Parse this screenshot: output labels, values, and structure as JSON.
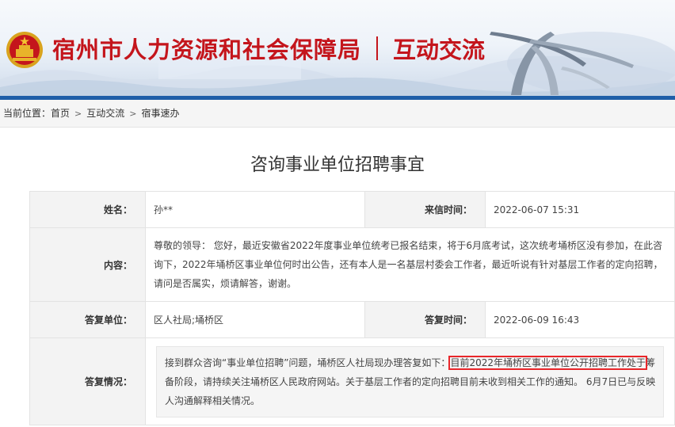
{
  "header": {
    "site_title": "宿州市人力资源和社会保障局",
    "section_title": "互动交流",
    "accent_color": "#c4151c",
    "stripe_color": "#1f5fa8"
  },
  "breadcrumb": {
    "prefix": "当前位置：",
    "items": [
      "首页",
      "互动交流",
      "宿事速办"
    ]
  },
  "page_title": "咨询事业单位招聘事宜",
  "details": {
    "name_label": "姓名：",
    "name_value": "孙**",
    "date_label": "来信时间：",
    "date_value": "2022-06-07 15:31",
    "content_label": "内容：",
    "content_value": "尊敬的领导： 您好，最近安徽省2022年度事业单位统考已报名结束，将于6月底考试，这次统考埇桥区没有参加，在此咨询下，2022年埇桥区事业单位何时出公告，还有本人是一名基层村委会工作者，最近听说有针对基层工作者的定向招聘，请问是否属实，烦请解答，谢谢。",
    "reply_unit_label": "答复单位：",
    "reply_unit_value": "区人社局;埇桥区",
    "reply_time_label": "答复时间：",
    "reply_time_value": "2022-06-09 16:43",
    "reply_label": "答复情况：",
    "reply_part1": "接到群众咨询“事业单位招聘”问题，埇桥区人社局现办理答复如下：",
    "reply_highlight": "目前2022年埇桥区事业单位公开招聘工作处于",
    "reply_part2": "筹备阶段，请持续关注埇桥区人民政府网站。关于基层工作者的定向招聘目前未收到相关工作的通知。 6月7日已与反映人沟通解释相关情况。",
    "highlight_color": "#e8262a"
  }
}
